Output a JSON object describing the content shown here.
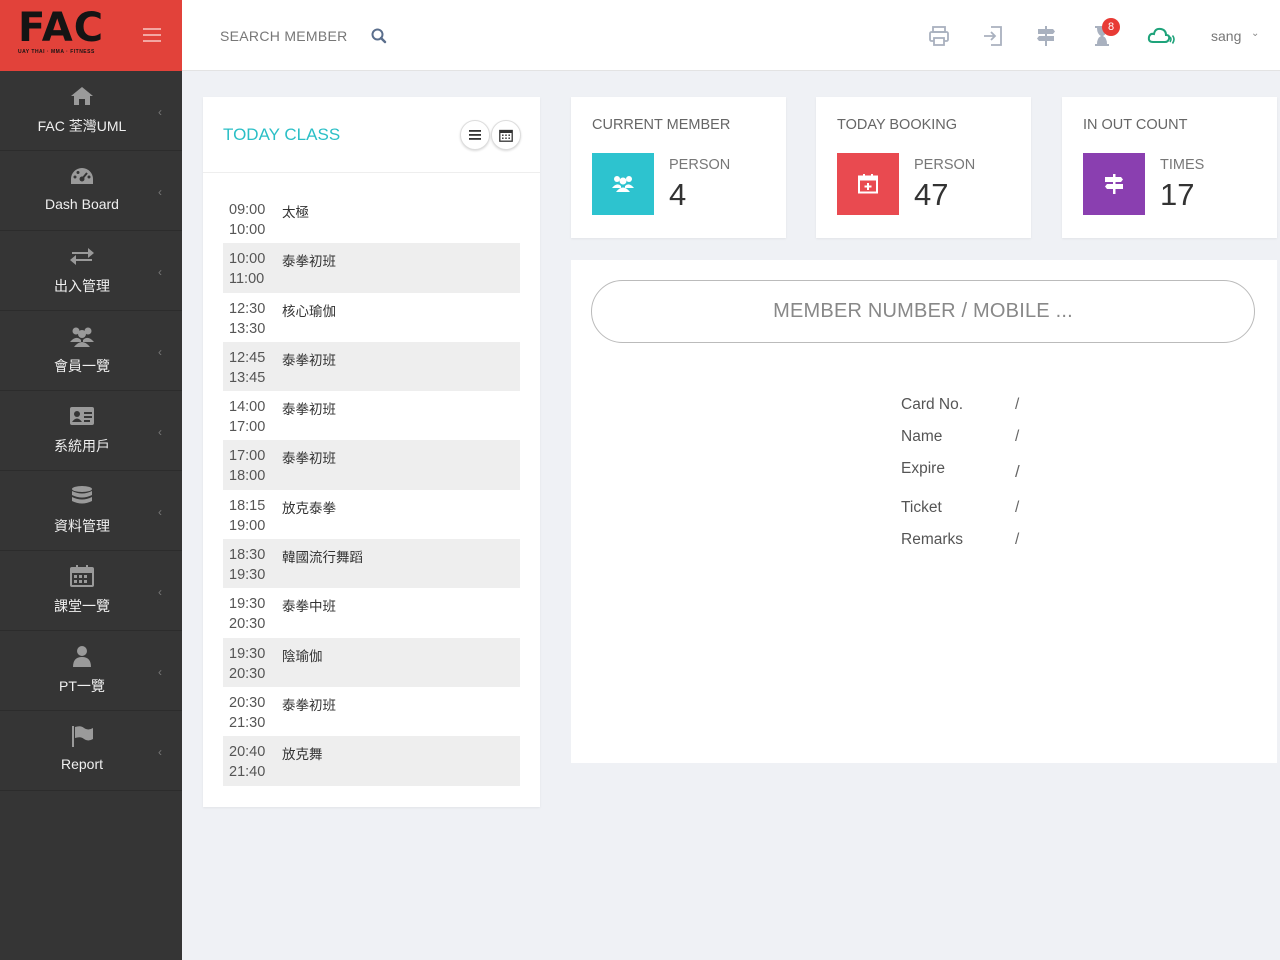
{
  "brand": {
    "logo_text": "FAC",
    "logo_tagline": "UAY THAI · MMA · FITNESS"
  },
  "sidebar": {
    "items": [
      {
        "label": "FAC 荃灣UML",
        "icon": "home-icon"
      },
      {
        "label": "Dash Board",
        "icon": "dashboard-icon"
      },
      {
        "label": "出入管理",
        "icon": "exchange-icon"
      },
      {
        "label": "會員一覽",
        "icon": "users-icon"
      },
      {
        "label": "系統用戶",
        "icon": "id-card-icon"
      },
      {
        "label": "資料管理",
        "icon": "database-icon"
      },
      {
        "label": "課堂一覽",
        "icon": "calendar-icon"
      },
      {
        "label": "PT一覽",
        "icon": "user-icon"
      },
      {
        "label": "Report",
        "icon": "flag-icon"
      }
    ]
  },
  "header": {
    "search_placeholder": "SEARCH MEMBER",
    "notification_count": "8",
    "username": "sang"
  },
  "today_class": {
    "title": "TODAY CLASS",
    "classes": [
      {
        "start": "09:00",
        "end": "10:00",
        "name": "太極"
      },
      {
        "start": "10:00",
        "end": "11:00",
        "name": "泰拳初班"
      },
      {
        "start": "12:30",
        "end": "13:30",
        "name": "核心瑜伽"
      },
      {
        "start": "12:45",
        "end": "13:45",
        "name": "泰拳初班"
      },
      {
        "start": "14:00",
        "end": "17:00",
        "name": "泰拳初班"
      },
      {
        "start": "17:00",
        "end": "18:00",
        "name": "泰拳初班"
      },
      {
        "start": "18:15",
        "end": "19:00",
        "name": "放克泰拳"
      },
      {
        "start": "18:30",
        "end": "19:30",
        "name": "韓國流行舞蹈"
      },
      {
        "start": "19:30",
        "end": "20:30",
        "name": "泰拳中班"
      },
      {
        "start": "19:30",
        "end": "20:30",
        "name": "陰瑜伽"
      },
      {
        "start": "20:30",
        "end": "21:30",
        "name": "泰拳初班"
      },
      {
        "start": "20:40",
        "end": "21:40",
        "name": "放克舞"
      }
    ]
  },
  "stats": {
    "current_member": {
      "title": "CURRENT MEMBER",
      "label": "PERSON",
      "value": "4",
      "color": "#2dc3cf"
    },
    "today_booking": {
      "title": "TODAY BOOKING",
      "label": "PERSON",
      "value": "47",
      "color": "#e94a50"
    },
    "in_out_count": {
      "title": "IN OUT COUNT",
      "label": "TIMES",
      "value": "17",
      "color": "#8a3fb0"
    }
  },
  "member_lookup": {
    "placeholder": "MEMBER NUMBER / MOBILE ...",
    "fields": [
      {
        "label": "Card No.",
        "value": "/"
      },
      {
        "label": "Name",
        "value": "/"
      },
      {
        "label": "Expire",
        "value": "/"
      },
      {
        "label": "Ticket",
        "value": "/"
      },
      {
        "label": "Remarks",
        "value": "/"
      }
    ]
  }
}
